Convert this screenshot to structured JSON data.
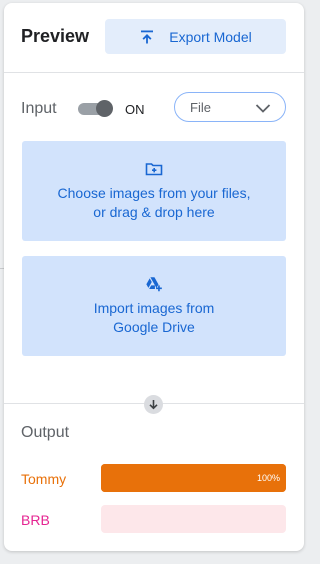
{
  "header": {
    "title": "Preview",
    "export_label": "Export Model",
    "export_icon": "upload-icon"
  },
  "input": {
    "label": "Input",
    "toggle_state": "ON",
    "toggle_on": true,
    "source_selected": "File"
  },
  "upload": {
    "files_line1": "Choose images from your files,",
    "files_line2": "or drag & drop here",
    "files_icon": "folder-add-icon",
    "drive_line1": "Import images from",
    "drive_line2": "Google Drive",
    "drive_icon": "google-drive-add-icon"
  },
  "output": {
    "title": "Output",
    "classes": [
      {
        "name": "Tommy",
        "percent_label": "100%",
        "confidence": 1.0,
        "color": "#e8710a",
        "track_color": "#e8710a"
      },
      {
        "name": "BRB",
        "percent_label": "",
        "confidence": 0.0,
        "color": "#e52592",
        "track_color": "#fde7ea"
      }
    ]
  },
  "colors": {
    "accent": "#1967d2",
    "upload_bg": "#d2e3fc",
    "export_bg": "#e3edfb"
  }
}
